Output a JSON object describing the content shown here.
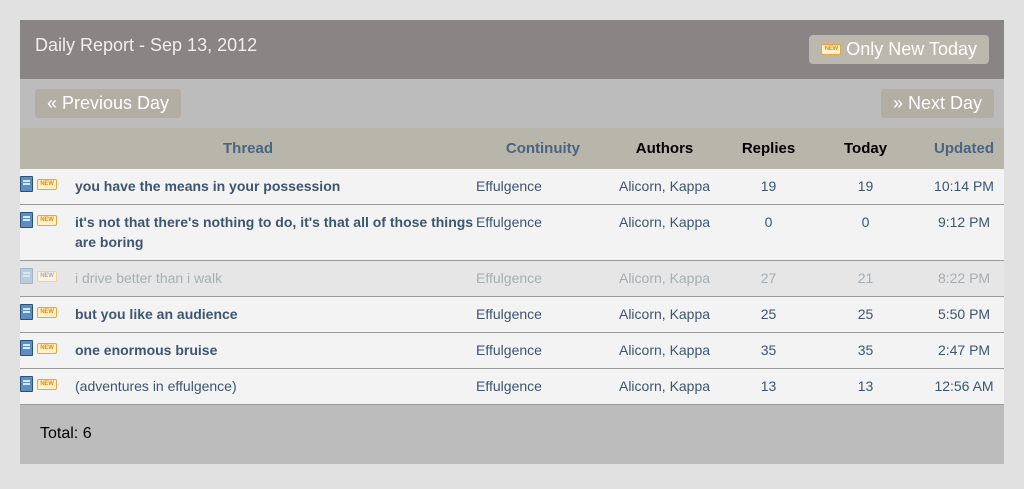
{
  "header": {
    "title": "Daily Report - Sep 13, 2012",
    "only_new_button": "Only New Today",
    "new_badge_text": "NEW"
  },
  "nav": {
    "prev_label": "« Previous Day",
    "next_label": "» Next Day"
  },
  "table": {
    "columns": [
      "Thread",
      "Continuity",
      "Authors",
      "Replies",
      "Today",
      "Updated"
    ],
    "rows": [
      {
        "title": "you have the means in your possession",
        "continuity": "Effulgence",
        "author1": "Alicorn",
        "author2": "Kappa",
        "replies": "19",
        "today": "19",
        "updated": "10:14 PM",
        "is_new": true,
        "dim": false,
        "bold": true
      },
      {
        "title": "it's not that there's nothing to do, it's that all of those things are boring",
        "continuity": "Effulgence",
        "author1": "Alicorn",
        "author2": "Kappa",
        "replies": "0",
        "today": "0",
        "updated": "9:12 PM",
        "is_new": true,
        "dim": false,
        "bold": true
      },
      {
        "title": "i drive better than i walk",
        "continuity": "Effulgence",
        "author1": "Alicorn",
        "author2": "Kappa",
        "replies": "27",
        "today": "21",
        "updated": "8:22 PM",
        "is_new": true,
        "dim": true,
        "bold": false
      },
      {
        "title": "but you like an audience",
        "continuity": "Effulgence",
        "author1": "Alicorn",
        "author2": "Kappa",
        "replies": "25",
        "today": "25",
        "updated": "5:50 PM",
        "is_new": true,
        "dim": false,
        "bold": true
      },
      {
        "title": "one enormous bruise",
        "continuity": "Effulgence",
        "author1": "Alicorn",
        "author2": "Kappa",
        "replies": "35",
        "today": "35",
        "updated": "2:47 PM",
        "is_new": true,
        "dim": false,
        "bold": true
      },
      {
        "title": "(adventures in effulgence)",
        "continuity": "Effulgence",
        "author1": "Alicorn",
        "author2": "Kappa",
        "replies": "13",
        "today": "13",
        "updated": "12:56 AM",
        "is_new": true,
        "dim": false,
        "bold": false
      }
    ]
  },
  "footer": {
    "total": "Total: 6"
  },
  "colors": {
    "header_bg": "#8a8585",
    "nav_bg": "#bcbcbc",
    "table_header_bg": "#b8b5ab",
    "link": "#3d5570"
  },
  "icons": {
    "thread": "book-icon",
    "new": "new-badge-icon"
  }
}
